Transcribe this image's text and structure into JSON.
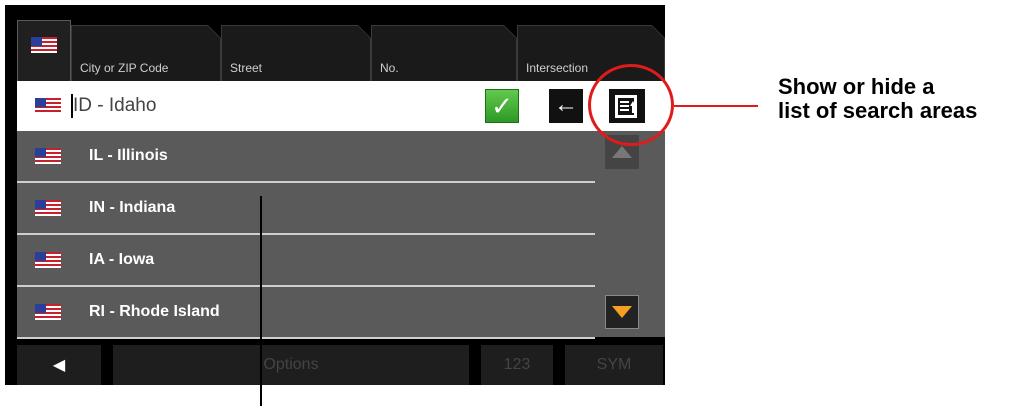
{
  "tabs": [
    {
      "label": ""
    },
    {
      "label": "City or ZIP Code"
    },
    {
      "label": "Street"
    },
    {
      "label": "No."
    },
    {
      "label": "Intersection"
    }
  ],
  "input": {
    "value": "ID - Idaho"
  },
  "list": {
    "items": [
      {
        "label": "IL - Illinois"
      },
      {
        "label": "IN - Indiana"
      },
      {
        "label": "IA - Iowa"
      },
      {
        "label": "RI - Rhode Island"
      }
    ]
  },
  "buttons": {
    "confirm": "✓",
    "back": "←"
  },
  "bottombar": {
    "back": "◀",
    "options": "Options",
    "numeric": "123",
    "symbols": "SYM"
  },
  "annotation": {
    "line1": "Show or hide a",
    "line2": "list of search areas"
  },
  "colors": {
    "accent_red": "#e01b1b",
    "confirm_green": "#3db033",
    "scroll_orange": "#f5a020"
  },
  "icons": {
    "flag": "us-flag-icon",
    "confirm": "check-icon",
    "back": "arrow-left-icon",
    "toggle": "list-toggle-icon"
  }
}
